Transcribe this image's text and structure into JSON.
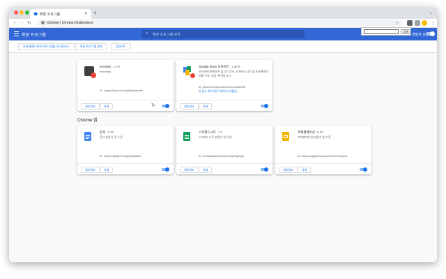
{
  "browser": {
    "tab_title": "확장 프로그램",
    "url_prefix": "Chrome",
    "url_path": "chrome://extensions",
    "find_button": "검색"
  },
  "header": {
    "title": "확장 프로그램",
    "search_placeholder": "확장 프로그램 검색",
    "dev_mode_label": "개발자 모드"
  },
  "actions": {
    "load_unpacked": "압축해제된 확장 프로그램을 로드합니다.",
    "pack": "확장 프로그램 압축",
    "update": "업데이트"
  },
  "extensions": [
    {
      "name": "tmoshrp",
      "version": "1.0.0",
      "desc": "tmcsharp",
      "id": "ID: oafgoefkcpmnhcomgfidblpiefeldie",
      "inspect": "",
      "details": "세부정보",
      "remove": "삭제"
    },
    {
      "name": "Google Docs 오프라인",
      "version": "1.29.0",
      "desc": "인터넷에 연결하지 않고도 문서, 스프레드시트 및 프레젠테이션을 수정, 생성, 확인합니다.",
      "id": "ID: ghbmnnjooekpmoecnnnilnnbdlolhkhi",
      "inspect": "뷰 검사 백그라운드 페이지 (비활성)",
      "details": "세부정보",
      "remove": "삭제"
    }
  ],
  "chrome_apps_heading": "Chrome 앱",
  "apps": [
    {
      "name": "문서",
      "version": "0.10",
      "desc": "문서 만들기 및 수정",
      "id": "ID: aohghmighlieanneiglcjnfllolkabe",
      "details": "세부정보",
      "remove": "삭제"
    },
    {
      "name": "스프레드시트",
      "version": "1.2",
      "desc": "스프레드시트 만들기 및 수정",
      "id": "ID: felcaaldnbdncclmgdcncolpebgiejap",
      "details": "세부정보",
      "remove": "삭제"
    },
    {
      "name": "프레젠테이션",
      "version": "0.10",
      "desc": "프레젠테이션 만들기 및 수정",
      "id": "ID: aapocclcgogkmnckokdopfmhonfmgoek",
      "details": "세부정보",
      "remove": "삭제"
    }
  ],
  "colors": {
    "header": "#3367d6",
    "accent": "#1a73e8",
    "docs": "#4285f4",
    "sheets": "#0f9d58",
    "slides": "#f4b400"
  }
}
